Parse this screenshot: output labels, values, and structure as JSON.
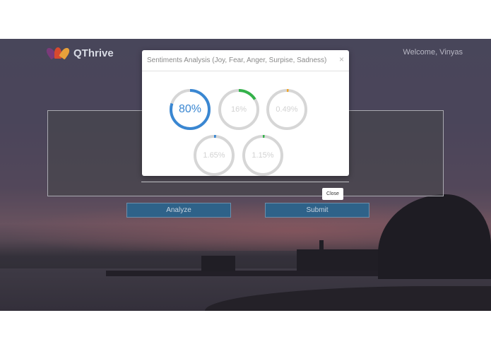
{
  "header": {
    "brand": "QThrive",
    "welcome": "Welcome, Vinyas"
  },
  "buttons": {
    "analyze": "Analyze",
    "submit": "Submit",
    "close": "Close"
  },
  "modal": {
    "title": "Sentiments Analysis (Joy, Fear, Anger, Surpise, Sadness)",
    "close_symbol": "×",
    "gauges": [
      {
        "name": "joy",
        "label": "80%",
        "percent": 80,
        "color": "#3a87d2",
        "text_color": "#3a87d2"
      },
      {
        "name": "fear",
        "label": "16%",
        "percent": 16,
        "color": "#34b24a",
        "text_color": "#d2d2d2"
      },
      {
        "name": "anger",
        "label": "0.49%",
        "percent": 0.49,
        "color": "#f0a52a",
        "text_color": "#d2d2d2"
      },
      {
        "name": "surprise",
        "label": "1.65%",
        "percent": 1.65,
        "color": "#3a87d2",
        "text_color": "#d2d2d2"
      },
      {
        "name": "sadness",
        "label": "1.15%",
        "percent": 1.15,
        "color": "#34b24a",
        "text_color": "#d2d2d2"
      }
    ]
  },
  "colors": {
    "track": "#d6d6d6",
    "button_bg": "#2e6289"
  }
}
